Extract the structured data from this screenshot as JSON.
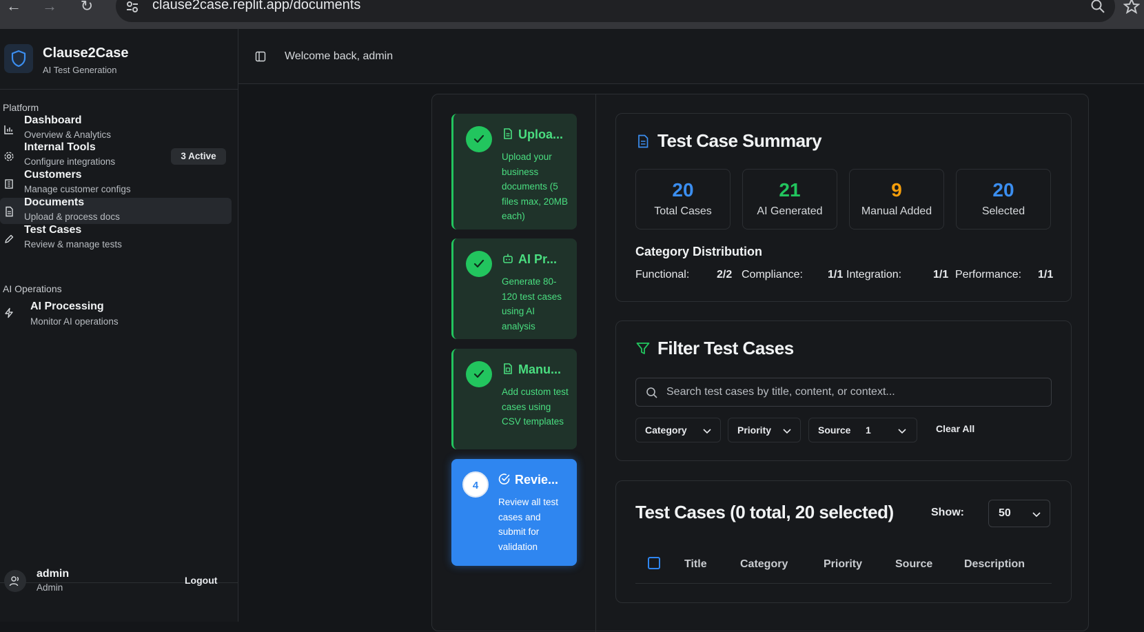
{
  "browser": {
    "url": "clause2case.replit.app/documents"
  },
  "brand": {
    "title": "Clause2Case",
    "subtitle": "AI Test Generation"
  },
  "sidebar": {
    "platform_label": "Platform",
    "ai_ops_label": "AI Operations",
    "items": [
      {
        "title": "Dashboard",
        "desc": "Overview & Analytics",
        "icon": "bar-chart-icon"
      },
      {
        "title": "Internal Tools",
        "desc": "Configure integrations",
        "icon": "gear-icon",
        "badge": "3 Active"
      },
      {
        "title": "Customers",
        "desc": "Manage customer configs",
        "icon": "building-icon"
      },
      {
        "title": "Documents",
        "desc": "Upload & process docs",
        "icon": "document-icon",
        "active": true
      },
      {
        "title": "Test Cases",
        "desc": "Review & manage tests",
        "icon": "pencil-icon"
      },
      {
        "title": "AI Processing",
        "desc": "Monitor AI operations",
        "icon": "lightning-icon"
      }
    ],
    "user": {
      "name": "admin",
      "role": "Admin",
      "logout": "Logout"
    }
  },
  "header": {
    "welcome": "Welcome back, admin"
  },
  "steps": [
    {
      "title": "Uploa...",
      "desc": "Upload your business documents (5 files max, 20MB each)",
      "state": "done"
    },
    {
      "title": "AI Pr...",
      "desc": "Generate 80-120 test cases using AI analysis",
      "state": "done"
    },
    {
      "title": "Manu...",
      "desc": "Add custom test cases using CSV templates",
      "state": "done"
    },
    {
      "number": "4",
      "title": "Revie...",
      "desc": "Review all test cases and submit for validation",
      "state": "current"
    }
  ],
  "summary": {
    "title": "Test Case Summary",
    "stats": [
      {
        "value": "20",
        "label": "Total Cases",
        "color": "#3b8ef0"
      },
      {
        "value": "21",
        "label": "AI Generated",
        "color": "#22c55e"
      },
      {
        "value": "9",
        "label": "Manual Added",
        "color": "#f59e0b"
      },
      {
        "value": "20",
        "label": "Selected",
        "color": "#3b8ef0"
      }
    ],
    "distribution_title": "Category Distribution",
    "distribution": [
      {
        "label": "Functional:",
        "value": "2/2"
      },
      {
        "label": "Compliance:",
        "value": "1/1"
      },
      {
        "label": "Integration:",
        "value": "1/1"
      },
      {
        "label": "Performance:",
        "value": "1/1"
      }
    ]
  },
  "filter": {
    "title": "Filter Test Cases",
    "search_placeholder": "Search test cases by title, content, or context...",
    "category_label": "Category",
    "priority_label": "Priority",
    "source_label": "Source",
    "source_count": "1",
    "clear_all": "Clear All"
  },
  "table": {
    "title": "Test Cases (0 total, 20 selected)",
    "show_label": "Show:",
    "show_value": "50",
    "columns": [
      "Title",
      "Category",
      "Priority",
      "Source",
      "Description"
    ]
  }
}
